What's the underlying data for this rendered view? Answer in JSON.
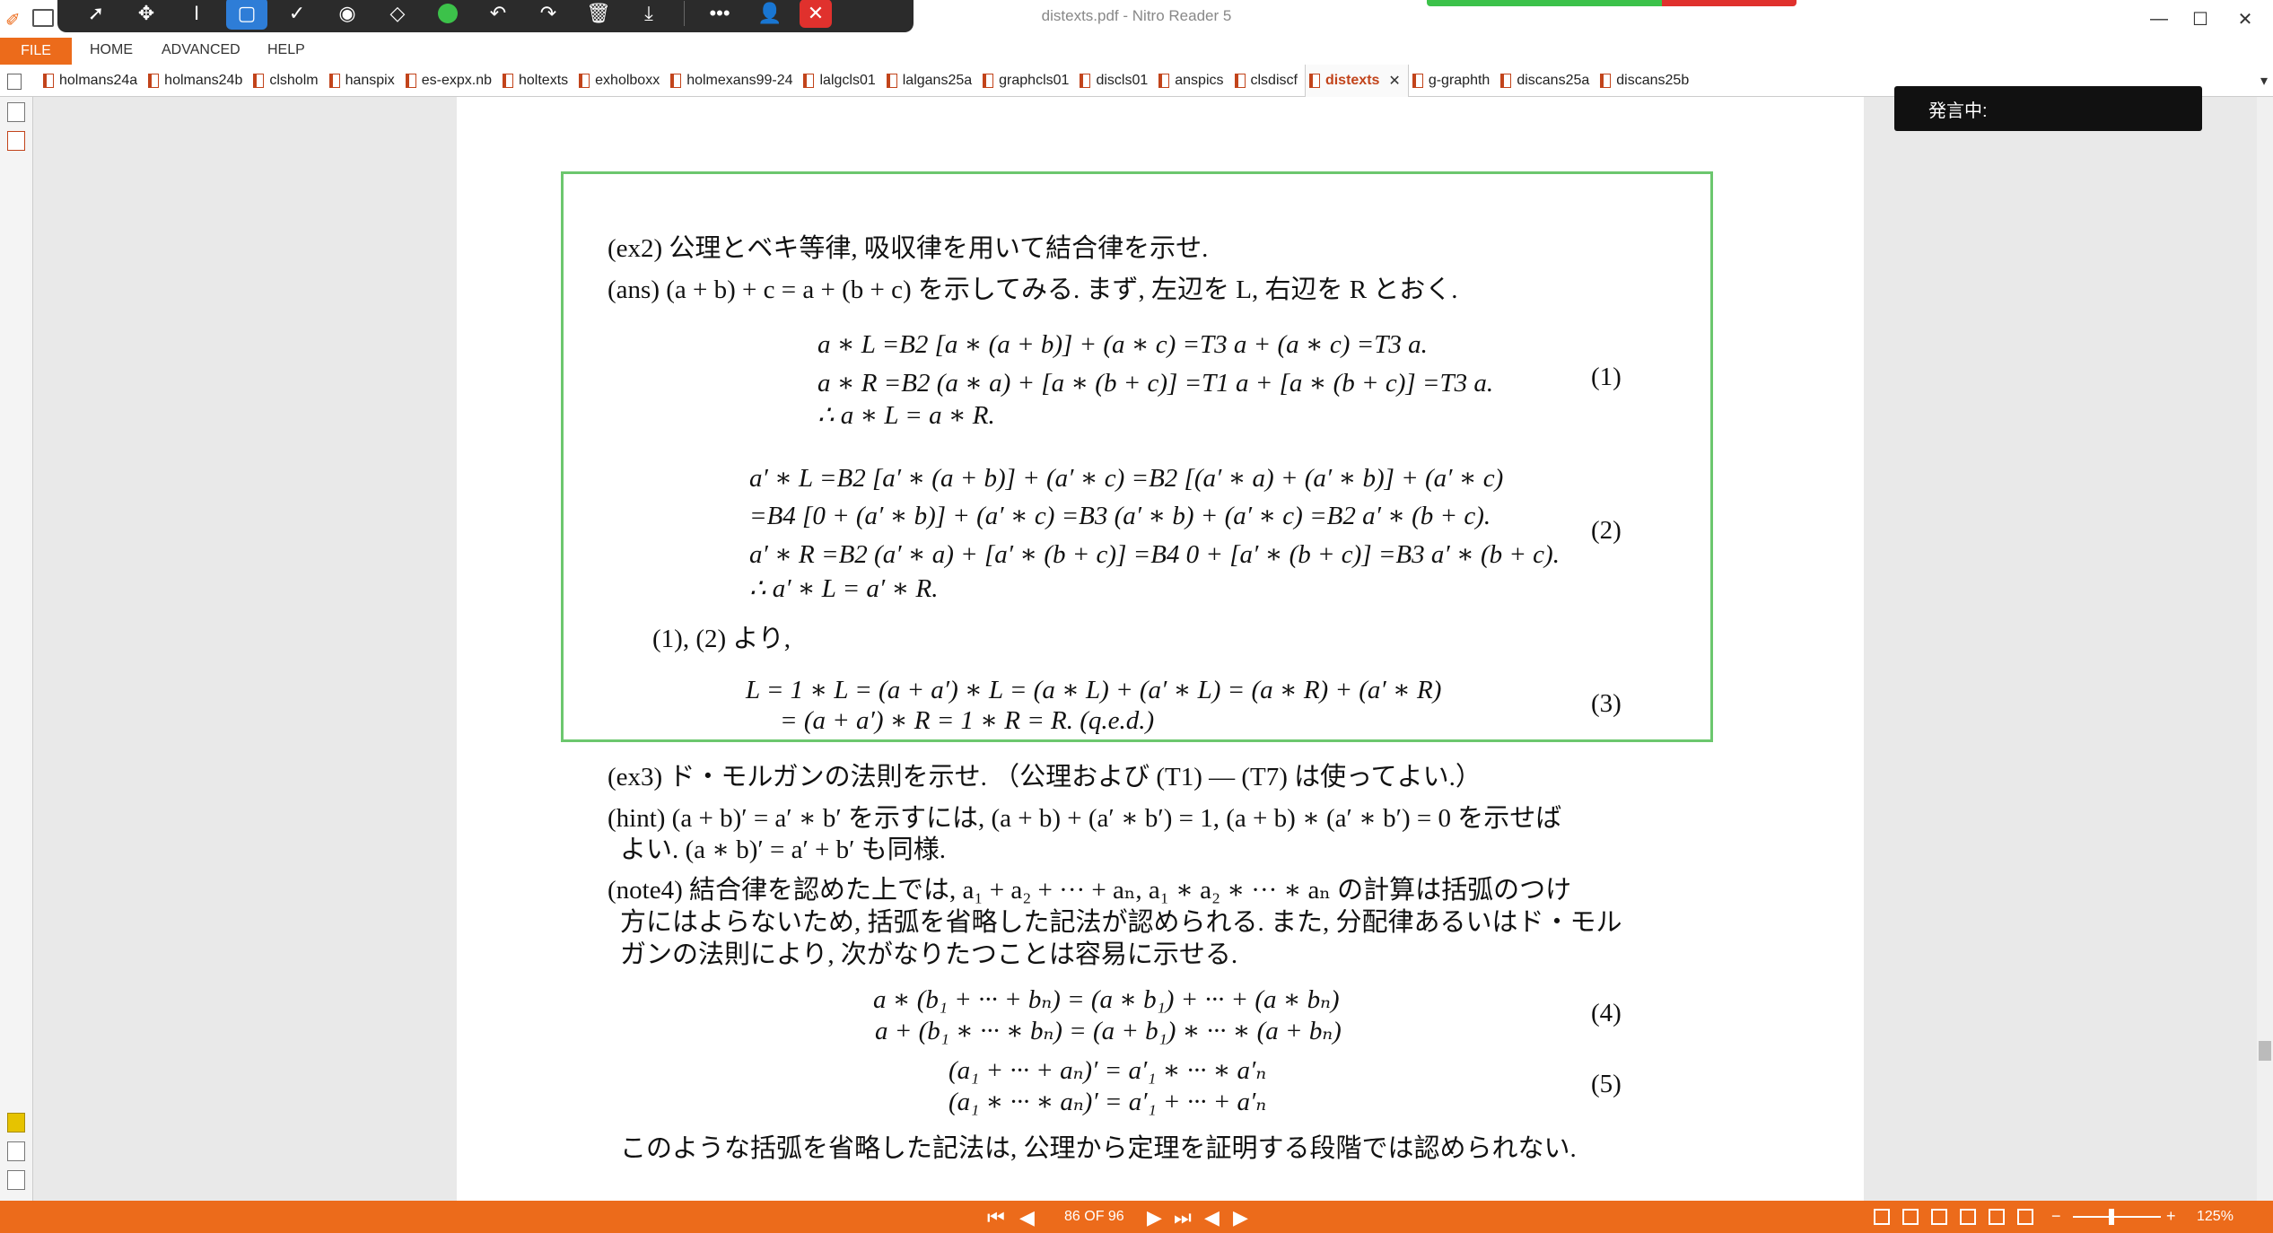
{
  "window": {
    "title": "distexts.pdf - Nitro Reader 5",
    "minimize": "—",
    "maximize": "☐",
    "close": "✕"
  },
  "menu": {
    "file": "FILE",
    "home": "HOME",
    "advanced": "ADVANCED",
    "help": "HELP"
  },
  "tabs": [
    {
      "label": "holmans24a"
    },
    {
      "label": "holmans24b"
    },
    {
      "label": "clsholm"
    },
    {
      "label": "hanspix"
    },
    {
      "label": "es-expx.nb"
    },
    {
      "label": "holtexts"
    },
    {
      "label": "exholboxx"
    },
    {
      "label": "holmexans99-24"
    },
    {
      "label": "lalgcls01"
    },
    {
      "label": "lalgans25a"
    },
    {
      "label": "graphcls01"
    },
    {
      "label": "discls01"
    },
    {
      "label": "anspics"
    },
    {
      "label": "clsdiscf"
    },
    {
      "label": "distexts",
      "active": true
    },
    {
      "label": "g-graphth"
    },
    {
      "label": "discans25a"
    },
    {
      "label": "discans25b"
    }
  ],
  "overlay": {
    "speaking": "発言中:"
  },
  "document": {
    "ex2": "(ex2)  公理とベキ等律, 吸収律を用いて結合律を示せ.",
    "ans": "(ans)  (a + b) + c = a + (b + c)  を示してみる. まず, 左辺を L, 右辺を R とおく.",
    "eq1_l1": "a ∗ L =B2 [a ∗ (a + b)] + (a ∗ c) =T3 a + (a ∗ c) =T3 a.",
    "eq1_l2": "a ∗ R =B2 (a ∗ a) + [a ∗ (b + c)] =T1 a + [a ∗ (b + c)] =T3 a.",
    "eq1_l3": "∴   a ∗ L = a ∗ R.",
    "eq2_l1": "a′ ∗ L =B2 [a′ ∗ (a + b)] + (a′ ∗ c) =B2 [(a′ ∗ a) + (a′ ∗ b)] + (a′ ∗ c)",
    "eq2_l2": "=B4 [0 + (a′ ∗ b)] + (a′ ∗ c) =B3 (a′ ∗ b) + (a′ ∗ c) =B2 a′ ∗ (b + c).",
    "eq2_l3": "a′ ∗ R =B2 (a′ ∗ a) + [a′ ∗ (b + c)] =B4 0 + [a′ ∗ (b + c)] =B3 a′ ∗ (b + c).",
    "eq2_l4": "∴   a′ ∗ L = a′ ∗ R.",
    "from12": "(1), (2) より,",
    "eq3_l1": "L   = 1 ∗ L = (a + a′) ∗ L = (a ∗ L) + (a′ ∗ L) = (a ∗ R) + (a′ ∗ R)",
    "eq3_l2": "= (a + a′) ∗ R = 1 ∗ R = R.        (q.e.d.)",
    "ex3": "(ex3)  ド・モルガンの法則を示せ. （公理および (T1) — (T7) は使ってよい.）",
    "hint_l1": "(hint)  (a + b)′ = a′ ∗ b′  を示すには, (a + b) + (a′ ∗ b′) = 1, (a + b) ∗ (a′ ∗ b′) = 0  を示せば",
    "hint_l2": "よい. (a ∗ b)′ = a′ + b′  も同様.",
    "note4_l1": "(note4)  結合律を認めた上では, a₁ + a₂ + ··· + aₙ,  a₁ ∗ a₂ ∗ ··· ∗ aₙ  の計算は括弧のつけ",
    "note4_l2": "方にはよらないため, 括弧を省略した記法が認められる. また, 分配律あるいはド・モル",
    "note4_l3": "ガンの法則により, 次がなりたつことは容易に示せる.",
    "eq4_l1": "a ∗ (b₁ + ··· + bₙ) = (a ∗ b₁) + ··· + (a ∗ bₙ)",
    "eq4_l2": "a + (b₁ ∗ ··· ∗ bₙ) = (a + b₁) ∗ ··· ∗ (a + bₙ)",
    "eq5_l1": "(a₁ + ··· + aₙ)′ = a′₁ ∗ ··· ∗ a′ₙ",
    "eq5_l2": "(a₁ ∗ ··· ∗ aₙ)′ = a′₁ + ··· + a′ₙ",
    "closing": "このような括弧を省略した記法は, 公理から定理を証明する段階では認められない.",
    "eqnums": [
      "(1)",
      "(2)",
      "(3)",
      "(4)",
      "(5)"
    ]
  },
  "status": {
    "page_indicator": "86 OF 96",
    "zoom": "125%",
    "zoom_minus": "−",
    "zoom_plus": "+"
  }
}
